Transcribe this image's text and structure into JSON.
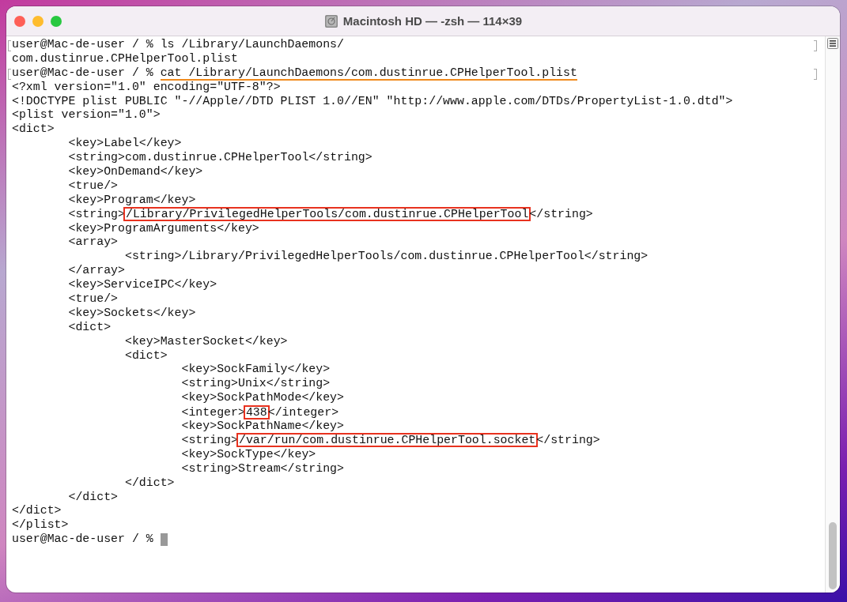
{
  "window": {
    "title": "Macintosh HD — -zsh — 114×39"
  },
  "terminal": {
    "lines": [
      {
        "marked": true,
        "segments": [
          {
            "text": "user@Mac-de-user / % ls /Library/LaunchDaemons/",
            "kind": "plain"
          }
        ]
      },
      {
        "marked": false,
        "segments": [
          {
            "text": "com.dustinrue.CPHelperTool.plist",
            "kind": "plain"
          }
        ]
      },
      {
        "marked": true,
        "segments": [
          {
            "text": "user@Mac-de-user / % ",
            "kind": "plain"
          },
          {
            "text": "cat /Library/LaunchDaemons/com.dustinrue.CPHelperTool.plist",
            "kind": "underlined"
          }
        ]
      },
      {
        "marked": false,
        "segments": [
          {
            "text": "<?xml version=\"1.0\" encoding=\"UTF-8\"?>",
            "kind": "plain"
          }
        ]
      },
      {
        "marked": false,
        "segments": [
          {
            "text": "<!DOCTYPE plist PUBLIC \"-//Apple//DTD PLIST 1.0//EN\" \"http://www.apple.com/DTDs/PropertyList-1.0.dtd\">",
            "kind": "plain"
          }
        ]
      },
      {
        "marked": false,
        "segments": [
          {
            "text": "<plist version=\"1.0\">",
            "kind": "plain"
          }
        ]
      },
      {
        "marked": false,
        "segments": [
          {
            "text": "<dict>",
            "kind": "plain"
          }
        ]
      },
      {
        "marked": false,
        "segments": [
          {
            "text": "\t<key>Label</key>",
            "kind": "plain"
          }
        ]
      },
      {
        "marked": false,
        "segments": [
          {
            "text": "\t<string>com.dustinrue.CPHelperTool</string>",
            "kind": "plain"
          }
        ]
      },
      {
        "marked": false,
        "segments": [
          {
            "text": "\t<key>OnDemand</key>",
            "kind": "plain"
          }
        ]
      },
      {
        "marked": false,
        "segments": [
          {
            "text": "\t<true/>",
            "kind": "plain"
          }
        ]
      },
      {
        "marked": false,
        "segments": [
          {
            "text": "\t<key>Program</key>",
            "kind": "plain"
          }
        ]
      },
      {
        "marked": false,
        "segments": [
          {
            "text": "\t<string>",
            "kind": "plain"
          },
          {
            "text": "/Library/PrivilegedHelperTools/com.dustinrue.CPHelperTool",
            "kind": "boxed"
          },
          {
            "text": "</string>",
            "kind": "plain"
          }
        ]
      },
      {
        "marked": false,
        "segments": [
          {
            "text": "\t<key>ProgramArguments</key>",
            "kind": "plain"
          }
        ]
      },
      {
        "marked": false,
        "segments": [
          {
            "text": "\t<array>",
            "kind": "plain"
          }
        ]
      },
      {
        "marked": false,
        "segments": [
          {
            "text": "\t\t<string>/Library/PrivilegedHelperTools/com.dustinrue.CPHelperTool</string>",
            "kind": "plain"
          }
        ]
      },
      {
        "marked": false,
        "segments": [
          {
            "text": "\t</array>",
            "kind": "plain"
          }
        ]
      },
      {
        "marked": false,
        "segments": [
          {
            "text": "\t<key>ServiceIPC</key>",
            "kind": "plain"
          }
        ]
      },
      {
        "marked": false,
        "segments": [
          {
            "text": "\t<true/>",
            "kind": "plain"
          }
        ]
      },
      {
        "marked": false,
        "segments": [
          {
            "text": "\t<key>Sockets</key>",
            "kind": "plain"
          }
        ]
      },
      {
        "marked": false,
        "segments": [
          {
            "text": "\t<dict>",
            "kind": "plain"
          }
        ]
      },
      {
        "marked": false,
        "segments": [
          {
            "text": "\t\t<key>MasterSocket</key>",
            "kind": "plain"
          }
        ]
      },
      {
        "marked": false,
        "segments": [
          {
            "text": "\t\t<dict>",
            "kind": "plain"
          }
        ]
      },
      {
        "marked": false,
        "segments": [
          {
            "text": "\t\t\t<key>SockFamily</key>",
            "kind": "plain"
          }
        ]
      },
      {
        "marked": false,
        "segments": [
          {
            "text": "\t\t\t<string>Unix</string>",
            "kind": "plain"
          }
        ]
      },
      {
        "marked": false,
        "segments": [
          {
            "text": "\t\t\t<key>SockPathMode</key>",
            "kind": "plain"
          }
        ]
      },
      {
        "marked": false,
        "segments": [
          {
            "text": "\t\t\t<integer>",
            "kind": "plain"
          },
          {
            "text": "438",
            "kind": "boxed"
          },
          {
            "text": "</integer>",
            "kind": "plain"
          }
        ]
      },
      {
        "marked": false,
        "segments": [
          {
            "text": "\t\t\t<key>SockPathName</key>",
            "kind": "plain"
          }
        ]
      },
      {
        "marked": false,
        "segments": [
          {
            "text": "\t\t\t<string>",
            "kind": "plain"
          },
          {
            "text": "/var/run/com.dustinrue.CPHelperTool.socket",
            "kind": "boxed"
          },
          {
            "text": "</string>",
            "kind": "plain"
          }
        ]
      },
      {
        "marked": false,
        "segments": [
          {
            "text": "\t\t\t<key>SockType</key>",
            "kind": "plain"
          }
        ]
      },
      {
        "marked": false,
        "segments": [
          {
            "text": "\t\t\t<string>Stream</string>",
            "kind": "plain"
          }
        ]
      },
      {
        "marked": false,
        "segments": [
          {
            "text": "\t\t</dict>",
            "kind": "plain"
          }
        ]
      },
      {
        "marked": false,
        "segments": [
          {
            "text": "\t</dict>",
            "kind": "plain"
          }
        ]
      },
      {
        "marked": false,
        "segments": [
          {
            "text": "</dict>",
            "kind": "plain"
          }
        ]
      },
      {
        "marked": false,
        "segments": [
          {
            "text": "</plist>",
            "kind": "plain"
          }
        ]
      }
    ],
    "prompt": {
      "text": "user@Mac-de-user / % ",
      "cursor": true
    }
  }
}
